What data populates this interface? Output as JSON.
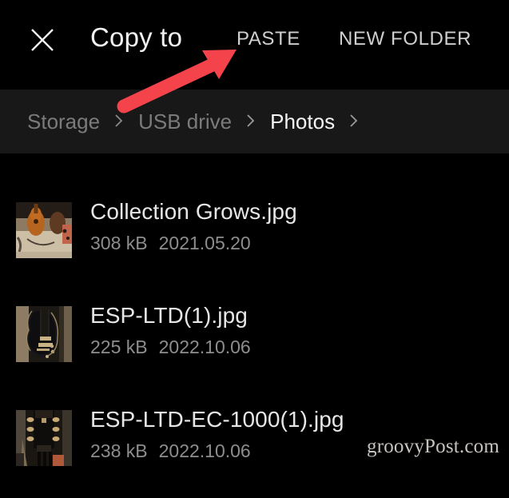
{
  "header": {
    "close_icon": "close-icon",
    "title": "Copy to",
    "paste_label": "PASTE",
    "new_folder_label": "NEW FOLDER"
  },
  "breadcrumb": {
    "separator_icon": "chevron-right-icon",
    "items": [
      {
        "label": "Storage",
        "current": false
      },
      {
        "label": "USB drive",
        "current": false
      },
      {
        "label": "Photos",
        "current": true
      }
    ]
  },
  "files": [
    {
      "name": "Collection Grows.jpg",
      "size": "308 kB",
      "date": "2021.05.20",
      "thumbnail": "acoustic-guitar-collection-photo"
    },
    {
      "name": "ESP-LTD(1).jpg",
      "size": "225 kB",
      "date": "2022.10.06",
      "thumbnail": "black-electric-guitar-photo"
    },
    {
      "name": "ESP-LTD-EC-1000(1).jpg",
      "size": "238 kB",
      "date": "2022.10.06",
      "thumbnail": "guitar-headstock-photo"
    }
  ],
  "annotation": {
    "arrow_icon": "red-arrow-pointing-up-right",
    "arrow_color": "#F4434A",
    "points_to": "PASTE"
  },
  "watermark": {
    "text": "groovyPost.com"
  },
  "colors": {
    "background": "#000000",
    "breadcrumb_bar": "#181818",
    "primary_text": "#f2f2f2",
    "secondary_text": "#8d8d8d",
    "accent_red": "#F4434A"
  }
}
